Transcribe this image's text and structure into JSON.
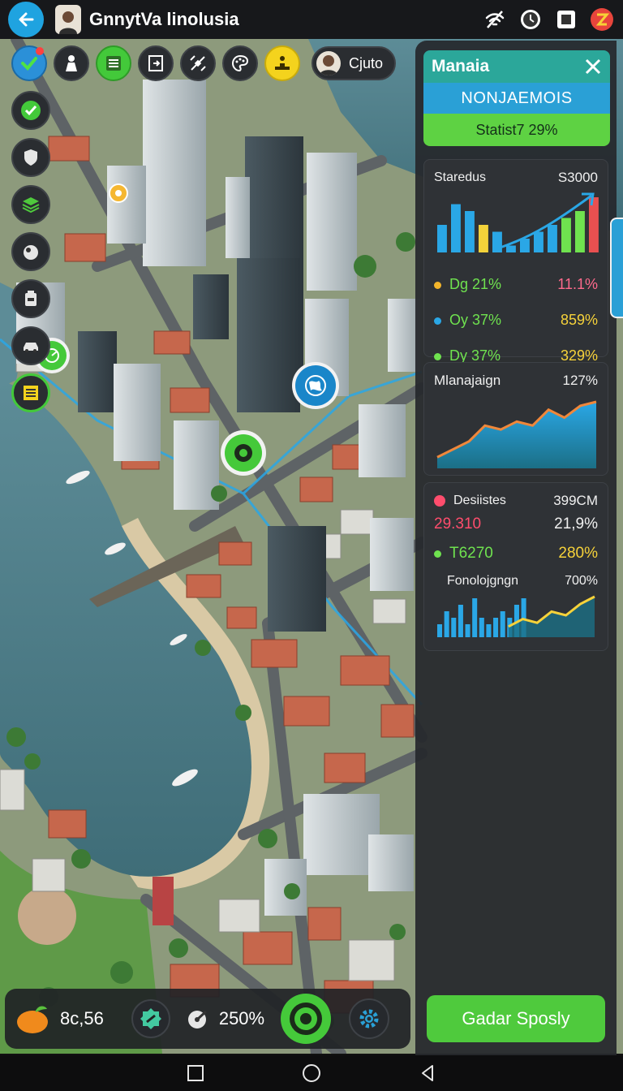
{
  "app": {
    "title": "GnnytVa linolusia"
  },
  "toolbar": {
    "user_label": "Cjuto"
  },
  "panel": {
    "title": "Manaia",
    "subtitle": "NONJAEMOIS",
    "status": "Statist7 29%",
    "card1": {
      "title": "Staredus",
      "value": "S3000",
      "rows": [
        {
          "label": "Dg 21%",
          "value": "11.1%",
          "dot_color": "#f3b52b",
          "label_color": "#6fe24f",
          "value_color": "#ff6a8c"
        },
        {
          "label": "Oy 37%",
          "value": "859%",
          "dot_color": "#2aa7e6",
          "label_color": "#6fe24f",
          "value_color": "#f6d23a"
        },
        {
          "label": "Dy 37%",
          "value": "329%",
          "dot_color": "#6fe24f",
          "label_color": "#6fe24f",
          "value_color": "#f6d23a"
        }
      ],
      "chart_data": {
        "type": "bar",
        "values": [
          4,
          7,
          6,
          4,
          3,
          1,
          2,
          3,
          4,
          5,
          6,
          8
        ],
        "colors": [
          "#2aa7e6",
          "#2aa7e6",
          "#2aa7e6",
          "#f3d23a",
          "#2aa7e6",
          "#2aa7e6",
          "#2aa7e6",
          "#2aa7e6",
          "#2aa7e6",
          "#6fe24f",
          "#6fe24f",
          "#e85050"
        ]
      }
    },
    "card2": {
      "title": "Mlanajaign",
      "value": "127%",
      "chart_data": {
        "type": "area",
        "values": [
          1,
          2,
          3,
          5,
          4.5,
          5.5,
          5,
          7,
          6,
          7.5,
          8
        ]
      }
    },
    "card3": {
      "title": "Desiistes",
      "value": "399CM",
      "dot_color": "#ff4d6d",
      "row1": {
        "label": "29.310",
        "value": "21,9%",
        "label_color": "#ff4d6d"
      },
      "row2": {
        "label": "T6270",
        "value": "280%",
        "dot_color": "#6fe24f",
        "label_color": "#6fe24f",
        "value_color": "#f6d23a"
      },
      "sub_title": "Fonolojgngn",
      "sub_value": "700%",
      "chart_data": {
        "type": "bar",
        "values": [
          2,
          4,
          3,
          5,
          2,
          6,
          3,
          2,
          3,
          4,
          3,
          5,
          6
        ],
        "line": [
          1,
          2,
          1.5,
          3,
          2.5,
          4,
          5
        ]
      }
    },
    "cta_label": "Gadar Sposly"
  },
  "hud": {
    "resource_value": "8c,56",
    "percent_value": "250%"
  },
  "colors": {
    "accent_green": "#4fca3d",
    "accent_blue": "#2aa0d6",
    "panel_bg": "#26282c"
  }
}
